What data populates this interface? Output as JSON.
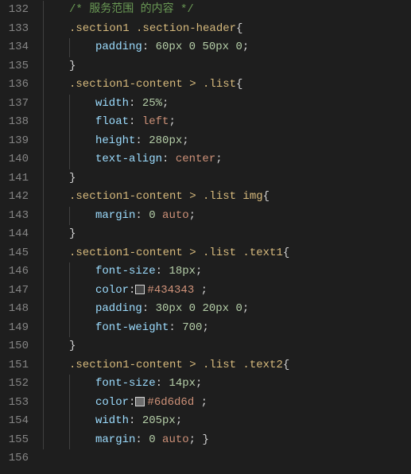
{
  "lines": [
    {
      "n": "132",
      "indent": 1,
      "segs": [
        {
          "cls": "c-comment",
          "t": "/* 服务范围 的内容 */"
        }
      ]
    },
    {
      "n": "133",
      "indent": 1,
      "segs": [
        {
          "cls": "c-selector",
          "t": ".section1 .section-header"
        },
        {
          "cls": "c-brace",
          "t": "{"
        }
      ]
    },
    {
      "n": "134",
      "indent": 2,
      "segs": [
        {
          "cls": "c-prop",
          "t": "padding"
        },
        {
          "cls": "c-punct",
          "t": ": "
        },
        {
          "cls": "c-num",
          "t": "60px"
        },
        {
          "cls": "c-punct",
          "t": " "
        },
        {
          "cls": "c-num",
          "t": "0"
        },
        {
          "cls": "c-punct",
          "t": " "
        },
        {
          "cls": "c-num",
          "t": "50px"
        },
        {
          "cls": "c-punct",
          "t": " "
        },
        {
          "cls": "c-num",
          "t": "0"
        },
        {
          "cls": "c-punct",
          "t": ";"
        }
      ]
    },
    {
      "n": "135",
      "indent": 1,
      "segs": [
        {
          "cls": "c-brace",
          "t": "}"
        }
      ]
    },
    {
      "n": "136",
      "indent": 1,
      "segs": [
        {
          "cls": "c-selector",
          "t": ".section1-content > .list"
        },
        {
          "cls": "c-brace",
          "t": "{"
        }
      ]
    },
    {
      "n": "137",
      "indent": 2,
      "segs": [
        {
          "cls": "c-prop",
          "t": "width"
        },
        {
          "cls": "c-punct",
          "t": ": "
        },
        {
          "cls": "c-num",
          "t": "25%"
        },
        {
          "cls": "c-punct",
          "t": ";"
        }
      ]
    },
    {
      "n": "138",
      "indent": 2,
      "segs": [
        {
          "cls": "c-prop",
          "t": "float"
        },
        {
          "cls": "c-punct",
          "t": ": "
        },
        {
          "cls": "c-val",
          "t": "left"
        },
        {
          "cls": "c-punct",
          "t": ";"
        }
      ]
    },
    {
      "n": "139",
      "indent": 2,
      "segs": [
        {
          "cls": "c-prop",
          "t": "height"
        },
        {
          "cls": "c-punct",
          "t": ": "
        },
        {
          "cls": "c-num",
          "t": "280px"
        },
        {
          "cls": "c-punct",
          "t": ";"
        }
      ]
    },
    {
      "n": "140",
      "indent": 2,
      "segs": [
        {
          "cls": "c-prop",
          "t": "text-align"
        },
        {
          "cls": "c-punct",
          "t": ": "
        },
        {
          "cls": "c-val",
          "t": "center"
        },
        {
          "cls": "c-punct",
          "t": ";"
        }
      ]
    },
    {
      "n": "141",
      "indent": 1,
      "segs": [
        {
          "cls": "c-brace",
          "t": "}"
        }
      ]
    },
    {
      "n": "142",
      "indent": 1,
      "segs": [
        {
          "cls": "c-selector",
          "t": ".section1-content > .list img"
        },
        {
          "cls": "c-brace",
          "t": "{"
        }
      ]
    },
    {
      "n": "143",
      "indent": 2,
      "segs": [
        {
          "cls": "c-prop",
          "t": "margin"
        },
        {
          "cls": "c-punct",
          "t": ": "
        },
        {
          "cls": "c-num",
          "t": "0"
        },
        {
          "cls": "c-punct",
          "t": " "
        },
        {
          "cls": "c-val",
          "t": "auto"
        },
        {
          "cls": "c-punct",
          "t": ";"
        }
      ]
    },
    {
      "n": "144",
      "indent": 1,
      "segs": [
        {
          "cls": "c-brace",
          "t": "}"
        }
      ]
    },
    {
      "n": "145",
      "indent": 1,
      "segs": [
        {
          "cls": "c-selector",
          "t": ".section1-content > .list .text1"
        },
        {
          "cls": "c-brace",
          "t": "{"
        }
      ]
    },
    {
      "n": "146",
      "indent": 2,
      "segs": [
        {
          "cls": "c-prop",
          "t": "font-size"
        },
        {
          "cls": "c-punct",
          "t": ": "
        },
        {
          "cls": "c-num",
          "t": "18px"
        },
        {
          "cls": "c-punct",
          "t": ";"
        }
      ]
    },
    {
      "n": "147",
      "indent": 2,
      "segs": [
        {
          "cls": "c-prop",
          "t": "color"
        },
        {
          "cls": "c-punct",
          "t": ":"
        },
        {
          "swatch": "#434343"
        },
        {
          "cls": "c-val",
          "t": "#434343 "
        },
        {
          "cls": "c-punct",
          "t": ";"
        }
      ]
    },
    {
      "n": "148",
      "indent": 2,
      "segs": [
        {
          "cls": "c-prop",
          "t": "padding"
        },
        {
          "cls": "c-punct",
          "t": ": "
        },
        {
          "cls": "c-num",
          "t": "30px"
        },
        {
          "cls": "c-punct",
          "t": " "
        },
        {
          "cls": "c-num",
          "t": "0"
        },
        {
          "cls": "c-punct",
          "t": " "
        },
        {
          "cls": "c-num",
          "t": "20px"
        },
        {
          "cls": "c-punct",
          "t": " "
        },
        {
          "cls": "c-num",
          "t": "0"
        },
        {
          "cls": "c-punct",
          "t": ";"
        }
      ]
    },
    {
      "n": "149",
      "indent": 2,
      "segs": [
        {
          "cls": "c-prop",
          "t": "font-weight"
        },
        {
          "cls": "c-punct",
          "t": ": "
        },
        {
          "cls": "c-num",
          "t": "700"
        },
        {
          "cls": "c-punct",
          "t": ";"
        }
      ]
    },
    {
      "n": "150",
      "indent": 1,
      "segs": [
        {
          "cls": "c-brace",
          "t": "}"
        }
      ]
    },
    {
      "n": "151",
      "indent": 1,
      "segs": [
        {
          "cls": "c-selector",
          "t": ".section1-content > .list .text2"
        },
        {
          "cls": "c-brace",
          "t": "{"
        }
      ]
    },
    {
      "n": "152",
      "indent": 2,
      "segs": [
        {
          "cls": "c-prop",
          "t": "font-size"
        },
        {
          "cls": "c-punct",
          "t": ": "
        },
        {
          "cls": "c-num",
          "t": "14px"
        },
        {
          "cls": "c-punct",
          "t": ";"
        }
      ]
    },
    {
      "n": "153",
      "indent": 2,
      "segs": [
        {
          "cls": "c-prop",
          "t": "color"
        },
        {
          "cls": "c-punct",
          "t": ":"
        },
        {
          "swatch": "#6d6d6d"
        },
        {
          "cls": "c-val",
          "t": "#6d6d6d "
        },
        {
          "cls": "c-punct",
          "t": ";"
        }
      ]
    },
    {
      "n": "154",
      "indent": 2,
      "segs": [
        {
          "cls": "c-prop",
          "t": "width"
        },
        {
          "cls": "c-punct",
          "t": ": "
        },
        {
          "cls": "c-num",
          "t": "205px"
        },
        {
          "cls": "c-punct",
          "t": ";"
        }
      ]
    },
    {
      "n": "155",
      "indent": 2,
      "segs": [
        {
          "cls": "c-prop",
          "t": "margin"
        },
        {
          "cls": "c-punct",
          "t": ": "
        },
        {
          "cls": "c-num",
          "t": "0"
        },
        {
          "cls": "c-punct",
          "t": " "
        },
        {
          "cls": "c-val",
          "t": "auto"
        },
        {
          "cls": "c-punct",
          "t": "; "
        },
        {
          "cls": "c-brace",
          "t": "}"
        }
      ]
    },
    {
      "n": "156",
      "indent": 0,
      "segs": []
    }
  ]
}
